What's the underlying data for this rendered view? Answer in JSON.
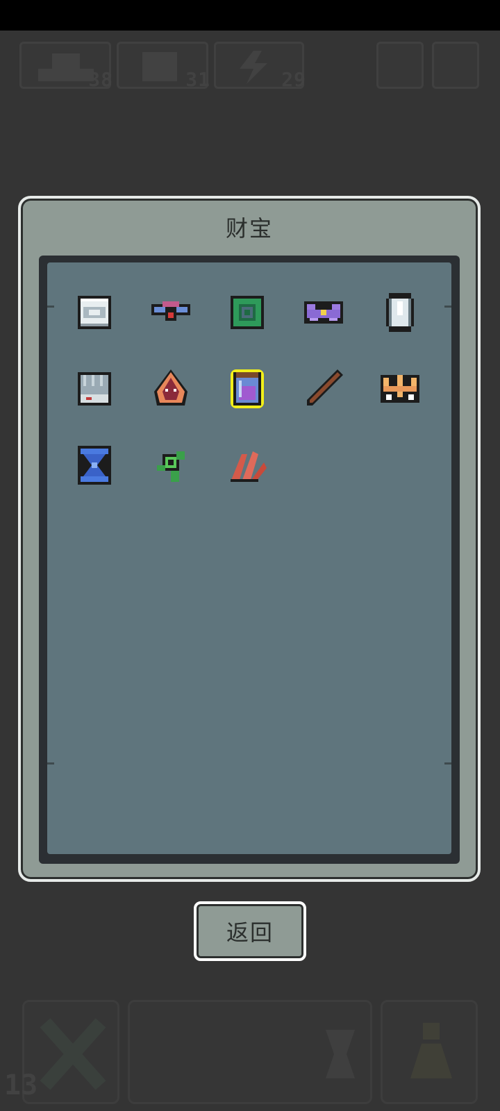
{
  "hud": {
    "stats": [
      {
        "icon": "monster-kills-icon",
        "value": "38"
      },
      {
        "icon": "scroll-icon",
        "value": "31"
      },
      {
        "icon": "energy-bolt-icon",
        "value": "29"
      }
    ],
    "hp": "13"
  },
  "panel": {
    "title": "财宝",
    "items": [
      {
        "name": "scroll-treasure-icon",
        "selected": false
      },
      {
        "name": "amulet-treasure-icon",
        "selected": false
      },
      {
        "name": "green-tome-treasure-icon",
        "selected": false
      },
      {
        "name": "purple-crown-treasure-icon",
        "selected": false
      },
      {
        "name": "mirror-treasure-icon",
        "selected": false
      },
      {
        "name": "gauntlet-treasure-icon",
        "selected": false
      },
      {
        "name": "red-hood-treasure-icon",
        "selected": false
      },
      {
        "name": "potion-jar-treasure-icon",
        "selected": true
      },
      {
        "name": "wooden-stick-treasure-icon",
        "selected": false
      },
      {
        "name": "golden-crown-treasure-icon",
        "selected": false
      },
      {
        "name": "hourglass-treasure-icon",
        "selected": false
      },
      {
        "name": "green-herb-treasure-icon",
        "selected": false
      },
      {
        "name": "red-feather-treasure-icon",
        "selected": false
      }
    ],
    "accent_color": "#f2ef1a"
  },
  "back_button": {
    "label": "返回"
  }
}
